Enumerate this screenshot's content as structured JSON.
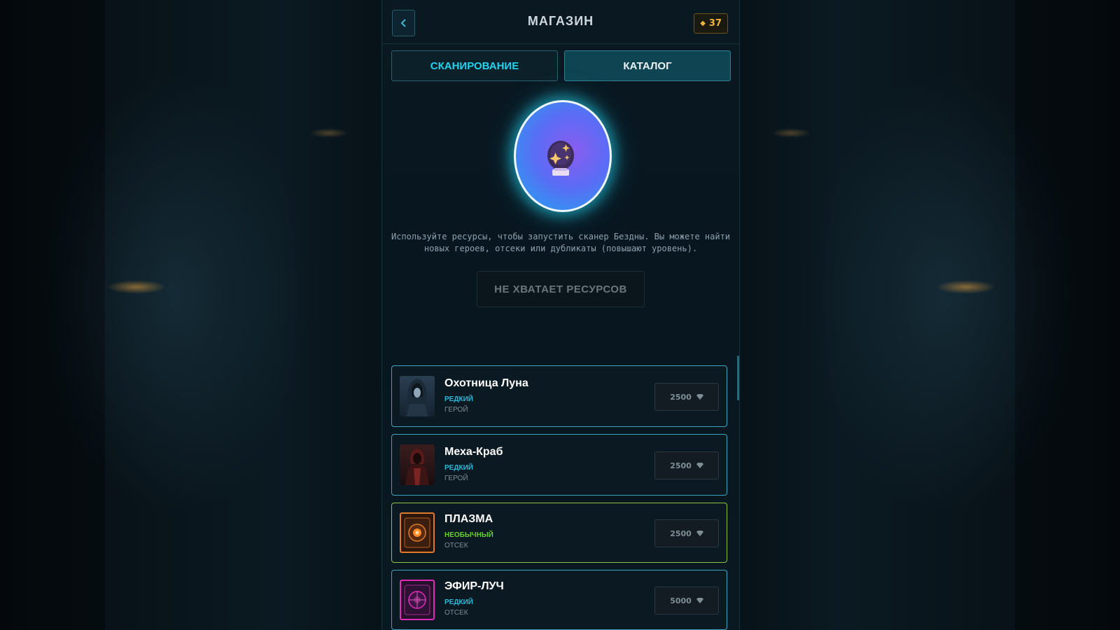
{
  "header": {
    "title": "МАГАЗИН",
    "currency_value": "37",
    "currency_icon": "diamond-icon",
    "currency_color": "#f0b43a"
  },
  "tabs": [
    {
      "label": "СКАНИРОВАНИЕ",
      "active": false,
      "color": "#22d3ee"
    },
    {
      "label": "КАТАЛОГ",
      "active": true
    }
  ],
  "scanner": {
    "icon": "crystal-ball-icon",
    "description": "Используйте ресурсы, чтобы запустить сканер Бездны. Вы можете найти новых героев, отсеки или дубликаты (повышают уровень).",
    "button_label": "НЕ ХВАТАЕТ РЕСУРСОВ"
  },
  "items": [
    {
      "name": "Охотница Луна",
      "rarity": "РЕДКИЙ",
      "type": "ГЕРОЙ",
      "price": "2500",
      "rarity_color": "#2fb6d8",
      "icon": "hooded-hunter-portrait"
    },
    {
      "name": "Меха-Краб",
      "rarity": "РЕДКИЙ",
      "type": "ГЕРОЙ",
      "price": "2500",
      "rarity_color": "#2fb6d8",
      "icon": "red-knight-portrait"
    },
    {
      "name": "ПЛАЗМА",
      "rarity": "НЕОБЫЧНЫЙ",
      "type": "ОТСЕК",
      "price": "2500",
      "rarity_color": "#5ed22a",
      "icon": "plasma-module-icon"
    },
    {
      "name": "ЭФИР-ЛУЧ",
      "rarity": "РЕДКИЙ",
      "type": "ОТСЕК",
      "price": "5000",
      "rarity_color": "#2fb6d8",
      "icon": "ether-beam-module-icon"
    }
  ]
}
